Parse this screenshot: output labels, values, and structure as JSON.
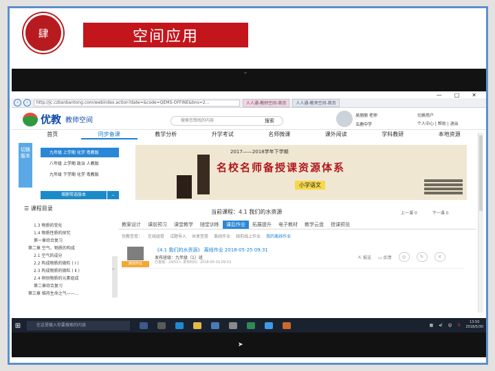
{
  "slide": {
    "badge": "肆",
    "title": "空间应用"
  },
  "browser": {
    "url": "http://jc.czbanbantong.com/webindex.action?date=&code=QEMS-OFFINE&bns=2...",
    "tabs": [
      "人人通-教师空间-首页",
      "人人通-教师空间-首页"
    ],
    "window_controls": [
      "—",
      "□",
      "✕"
    ]
  },
  "header": {
    "logo_name": "优教",
    "logo_sub": "教师空间",
    "search_placeholder": "搜索您想找的内容",
    "search_button": "搜索",
    "user_name": "吴丽丽 老师",
    "user_school": "五鹿中学",
    "links": [
      "切换用户",
      "个人中心",
      "帮助",
      "退出"
    ]
  },
  "nav": [
    "首页",
    "同步备课",
    "教学分析",
    "升学考试",
    "名师微课",
    "课外阅读",
    "学科教研",
    "本地资源"
  ],
  "nav_active_index": 1,
  "version": {
    "box_label": "切换版本",
    "items": [
      "九年级 上学期 化学 粤教版",
      "八年级 上学期 政治 人教版",
      "九年级 下学期 化学 粤教版"
    ],
    "selected_index": 0,
    "add_button": "增删常选版本"
  },
  "banner": {
    "year": "2017——2018学年下学期",
    "main": "名校名师备授课资源体系",
    "tag": "小学语文"
  },
  "syllabus": {
    "title": "课程目录",
    "items": [
      "1.3 物质的变化",
      "1.4 物质性质的探究",
      "第一章综合复习",
      "第二章 空气、物质的构成",
      "2.1 空气的成分",
      "2.2 构成物质的微粒 ( Ⅰ )",
      "2.3 构成物质的微粒 ( Ⅱ )",
      "2.4 辨别物质的元素组成",
      "第二章综合复习",
      "第三章 维持生命之气——..."
    ]
  },
  "content": {
    "current": "当前课程：4.1 我们的水资源",
    "prev": "上一课 0",
    "next": "下一课 0",
    "subtabs": [
      "教案设计",
      "课前预习",
      "课堂教学",
      "随堂训练",
      "课后作业",
      "拓展提升",
      "电子教材",
      "教学云盘",
      "授课预览"
    ],
    "subtab_active_index": 4,
    "filters": [
      "优教签卷：",
      "在线组卷",
      "试题导入",
      "共享签卷",
      "离线作业",
      "线前线上作业",
      "我的离线作业"
    ],
    "filter_active_index": 6,
    "homework": {
      "label": "离线作业",
      "title": "《4.1 我们的水资源》 离线作业 2018-05-25 09:31",
      "class": "发布班级：九年级（1）班",
      "stats": "已答题：24/55人  发布时间：2018-05-10 09:53",
      "actions": [
        "报送",
        "反馈"
      ]
    }
  },
  "taskbar": {
    "search_placeholder": "在这里输入你要搜索的内容",
    "ime": "中",
    "time": "13:50",
    "date": "2018/5/30"
  }
}
